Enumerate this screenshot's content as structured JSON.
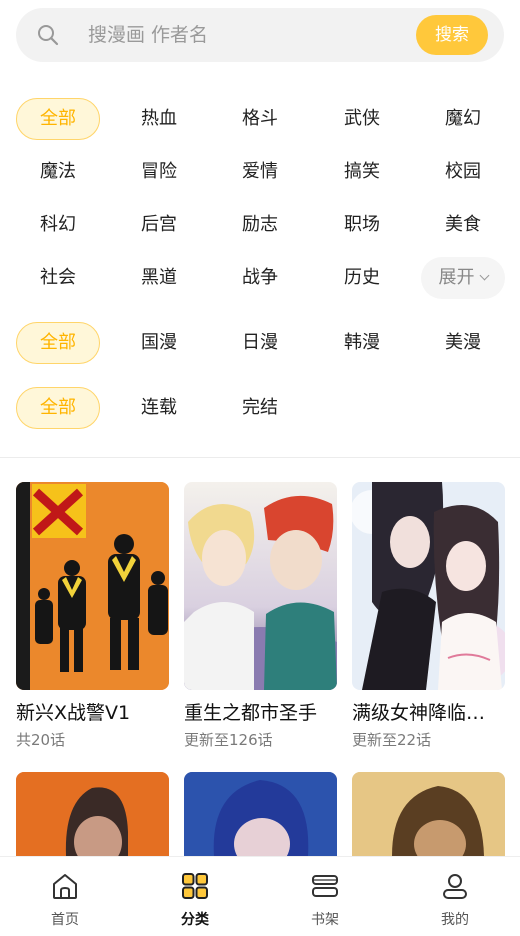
{
  "search": {
    "placeholder": "搜漫画 作者名",
    "button_label": "搜索"
  },
  "filters": {
    "genre": [
      "全部",
      "热血",
      "格斗",
      "武侠",
      "魔幻",
      "魔法",
      "冒险",
      "爱情",
      "搞笑",
      "校园",
      "科幻",
      "后宫",
      "励志",
      "职场",
      "美食",
      "社会",
      "黑道",
      "战争",
      "历史"
    ],
    "expand_label": "展开",
    "region": [
      "全部",
      "国漫",
      "日漫",
      "韩漫",
      "美漫"
    ],
    "status": [
      "全部",
      "连载",
      "完结"
    ]
  },
  "comics": [
    {
      "title": "新兴X战警V1",
      "subtitle": "共20话"
    },
    {
      "title": "重生之都市圣手",
      "subtitle": "更新至126话"
    },
    {
      "title": "满级女神降临…",
      "subtitle": "更新至22话"
    }
  ],
  "bottom_nav": [
    {
      "label": "首页",
      "icon": "home-icon"
    },
    {
      "label": "分类",
      "icon": "category-icon"
    },
    {
      "label": "书架",
      "icon": "bookshelf-icon"
    },
    {
      "label": "我的",
      "icon": "profile-icon"
    }
  ],
  "colors": {
    "accent": "#ffc83b",
    "active_chip_bg": "#fff7d9",
    "active_chip_text": "#ffb400"
  }
}
